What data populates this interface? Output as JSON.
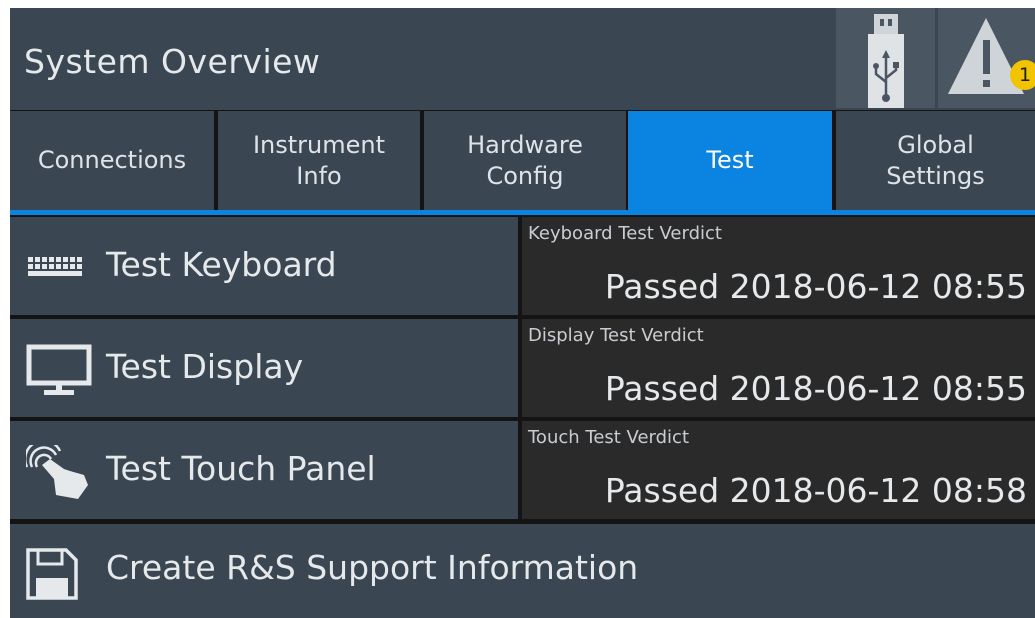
{
  "header": {
    "title": "System Overview",
    "usb_icon": "usb-icon",
    "warning_icon": "warning-icon",
    "warning_count": "1"
  },
  "tabs": [
    {
      "label": "Connections"
    },
    {
      "label": "Instrument\nInfo"
    },
    {
      "label": "Hardware\nConfig"
    },
    {
      "label": "Test"
    },
    {
      "label": "Global\nSettings"
    }
  ],
  "active_tab": "Test",
  "tests": [
    {
      "icon": "keyboard-icon",
      "label": "Test Keyboard",
      "verdict_title": "Keyboard Test Verdict",
      "verdict": "Passed 2018-06-12 08:55"
    },
    {
      "icon": "monitor-icon",
      "label": "Test Display",
      "verdict_title": "Display Test Verdict",
      "verdict": "Passed 2018-06-12 08:55"
    },
    {
      "icon": "touch-icon",
      "label": "Test Touch Panel",
      "verdict_title": "Touch Test Verdict",
      "verdict": "Passed 2018-06-12 08:58"
    }
  ],
  "support": {
    "icon": "floppy-disk-icon",
    "label": "Create R&S Support Information"
  },
  "colors": {
    "accent": "#0a84e0",
    "panel": "#3a4652",
    "badge": "#f2c400"
  }
}
